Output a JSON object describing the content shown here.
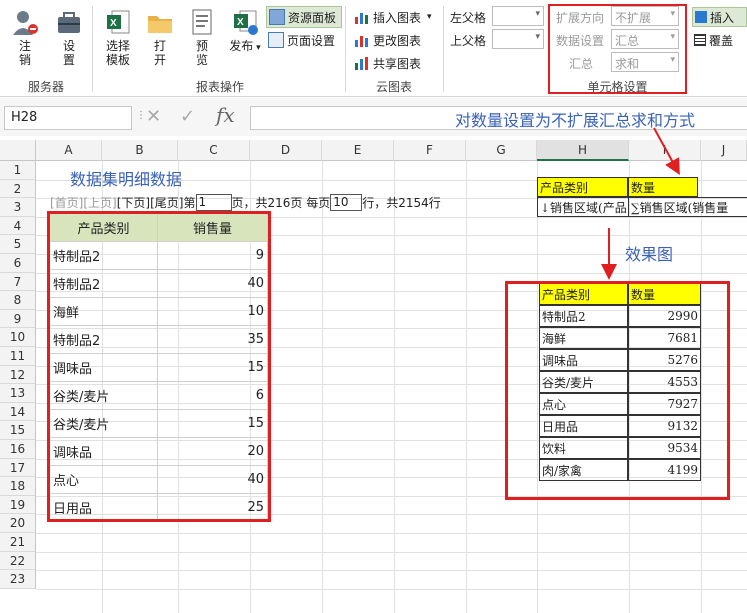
{
  "ribbon": {
    "server_group": {
      "label": "服务器",
      "logout": "注\n销",
      "settings": "设\n置"
    },
    "report_group": {
      "label": "报表操作",
      "select_template": "选择\n模板",
      "open": "打\n开",
      "preview": "预\n览",
      "publish": "发布"
    },
    "resource_panel": "资源面板",
    "page_setup": "页面设置",
    "chart_group": {
      "label": "云图表",
      "insert": "插入图表",
      "modify": "更改图表",
      "share": "共享图表"
    },
    "parent": {
      "left": "左父格",
      "top": "上父格"
    },
    "cell_settings": {
      "label": "单元格设置",
      "expand_label": "扩展方向",
      "expand_value": "不扩展",
      "data_label": "数据设置",
      "data_value": "汇总",
      "sum_label": "汇总",
      "sum_value": "求和"
    },
    "insert": "插入",
    "cover": "覆盖"
  },
  "formula": {
    "name_box": "H28",
    "annotation": "对数量设置为不扩展汇总求和方式"
  },
  "columns": [
    "A",
    "B",
    "C",
    "D",
    "E",
    "F",
    "G",
    "H",
    "I",
    "J"
  ],
  "rows": [
    "1",
    "2",
    "3",
    "4",
    "5",
    "6",
    "7",
    "8",
    "9",
    "10",
    "11",
    "12",
    "13",
    "14",
    "15",
    "16",
    "17",
    "18",
    "19",
    "20",
    "21",
    "22",
    "23"
  ],
  "sheet": {
    "title": "数据集明细数据",
    "pager": {
      "first": "[首页]",
      "prev": "[上页]",
      "next": "[下页]",
      "last": "[尾页]",
      "page_prefix": "第",
      "page_value": "1",
      "page_suffix": "页，共216页 每页",
      "size_value": "10",
      "size_suffix": "行，共2154行"
    },
    "table": {
      "headers": [
        "产品类别",
        "销售量"
      ],
      "rows": [
        [
          "特制品2",
          "9"
        ],
        [
          "特制品2",
          "40"
        ],
        [
          "海鲜",
          "10"
        ],
        [
          "特制品2",
          "35"
        ],
        [
          "调味品",
          "15"
        ],
        [
          "谷类/麦片",
          "6"
        ],
        [
          "谷类/麦片",
          "15"
        ],
        [
          "调味品",
          "20"
        ],
        [
          "点心",
          "40"
        ],
        [
          "日用品",
          "25"
        ]
      ]
    },
    "template": {
      "headers": [
        "产品类别",
        "数量"
      ],
      "cells": [
        "↓销售区域(产品",
        "∑销售区域(销售量"
      ]
    },
    "result_label": "效果图",
    "result": {
      "headers": [
        "产品类别",
        "数量"
      ],
      "rows": [
        [
          "特制品2",
          "2990"
        ],
        [
          "海鲜",
          "7681"
        ],
        [
          "调味品",
          "5276"
        ],
        [
          "谷类/麦片",
          "4553"
        ],
        [
          "点心",
          "7927"
        ],
        [
          "日用品",
          "9132"
        ],
        [
          "饮料",
          "9534"
        ],
        [
          "肉/家禽",
          "4199"
        ]
      ]
    }
  },
  "colors": {
    "accent_red": "#e02020",
    "header_green": "#d8e4bc",
    "yellow": "#ffff00",
    "note_blue": "#3a62b8"
  }
}
